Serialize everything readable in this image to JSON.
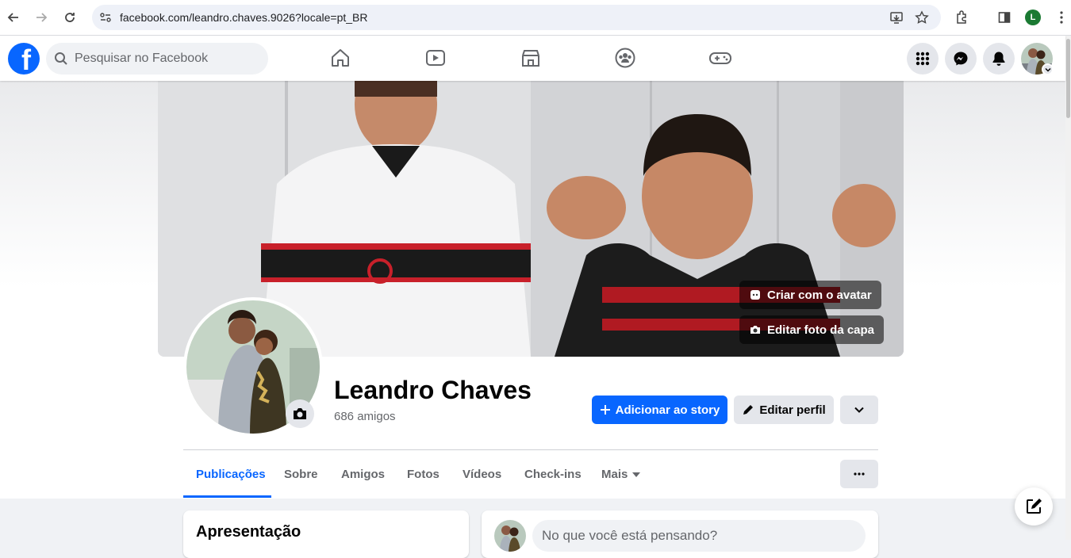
{
  "browser": {
    "url": "facebook.com/leandro.chaves.9026?locale=pt_BR",
    "profile_initial": "L"
  },
  "topbar": {
    "search_placeholder": "Pesquisar no Facebook",
    "nav_icons": [
      "home-icon",
      "video-icon",
      "marketplace-icon",
      "groups-icon",
      "gaming-icon"
    ],
    "action_icons": [
      "menu-grid-icon",
      "messenger-icon",
      "notifications-icon"
    ]
  },
  "cover": {
    "avatar_button": "Criar com o avatar",
    "edit_cover_button": "Editar foto da capa"
  },
  "profile": {
    "name": "Leandro Chaves",
    "friends": "686 amigos",
    "add_story_button": "Adicionar ao story",
    "edit_profile_button": "Editar perfil"
  },
  "tabs": [
    {
      "label": "Publicações",
      "active": true
    },
    {
      "label": "Sobre"
    },
    {
      "label": "Amigos"
    },
    {
      "label": "Fotos"
    },
    {
      "label": "Vídeos"
    },
    {
      "label": "Check-ins"
    },
    {
      "label": "Mais"
    }
  ],
  "intro": {
    "title": "Apresentação"
  },
  "composer": {
    "placeholder": "No que você está pensando?"
  },
  "colors": {
    "accent": "#0866ff",
    "background": "#f0f2f5",
    "secondary_button": "#e4e6eb"
  }
}
